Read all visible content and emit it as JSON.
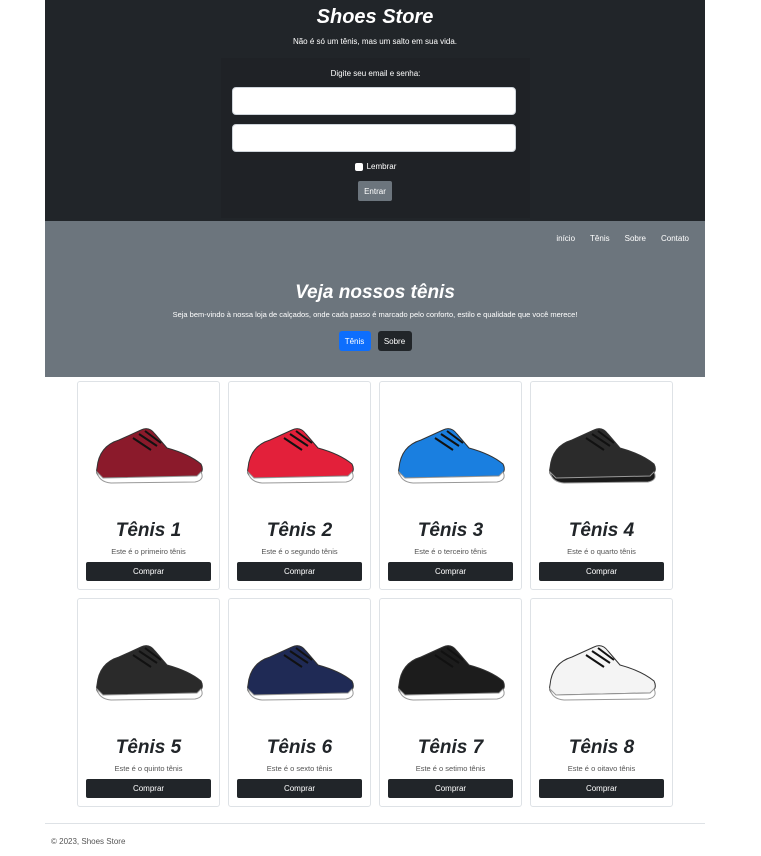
{
  "header": {
    "brand": "Shoes Store",
    "tagline": "Não é só um tênis, mas um salto em sua vida.",
    "login": {
      "prompt": "Digite seu email e senha:",
      "email_value": "",
      "password_value": "",
      "remember_label": "Lembrar",
      "submit_label": "Entrar"
    }
  },
  "nav": {
    "items": [
      "início",
      "Tênis",
      "Sobre",
      "Contato"
    ]
  },
  "hero": {
    "title": "Veja nossos tênis",
    "text": "Seja bem-vindo à nossa loja de calçados, onde cada passo é marcado pelo conforto, estilo e qualidade que você merece!",
    "btn_primary": "Tênis",
    "btn_secondary": "Sobre"
  },
  "products": [
    {
      "title": "Tênis 1",
      "text": "Este é o primeiro tênis",
      "button": "Comprar",
      "color": "#8b1a2b",
      "sole": "#ffffff"
    },
    {
      "title": "Tênis 2",
      "text": "Este é o segundo tênis",
      "button": "Comprar",
      "color": "#e3203a",
      "sole": "#ffffff"
    },
    {
      "title": "Tênis 3",
      "text": "Este é o terceiro tênis",
      "button": "Comprar",
      "color": "#1a7fe0",
      "sole": "#ffffff"
    },
    {
      "title": "Tênis 4",
      "text": "Este é o quarto tênis",
      "button": "Comprar",
      "color": "#2b2b2b",
      "sole": "#1a1a1a"
    },
    {
      "title": "Tênis 5",
      "text": "Este é o quinto tênis",
      "button": "Comprar",
      "color": "#2a2a2a",
      "sole": "#ffffff"
    },
    {
      "title": "Tênis 6",
      "text": "Este é o sexto tênis",
      "button": "Comprar",
      "color": "#1f2a55",
      "sole": "#ffffff"
    },
    {
      "title": "Tênis 7",
      "text": "Este é o setimo tênis",
      "button": "Comprar",
      "color": "#1c1c1c",
      "sole": "#ffffff"
    },
    {
      "title": "Tênis 8",
      "text": "Este é o oitavo tênis",
      "button": "Comprar",
      "color": "#f4f4f4",
      "sole": "#ffffff"
    }
  ],
  "footer": {
    "text": "© 2023, Shoes Store"
  }
}
